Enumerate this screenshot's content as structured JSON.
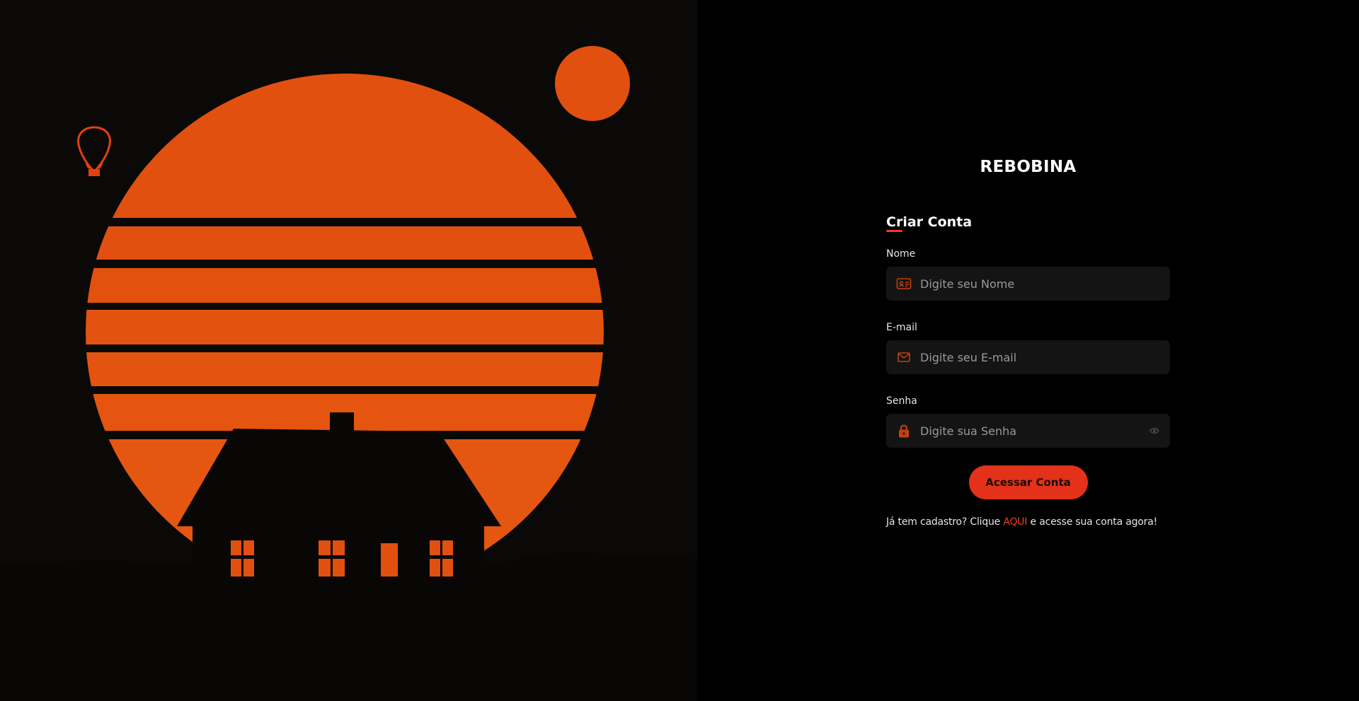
{
  "brand": {
    "name": "REBOBINA"
  },
  "form": {
    "title": "Criar Conta",
    "fields": [
      {
        "label": "Nome",
        "placeholder": "Digite seu Nome",
        "icon": "id-card-icon"
      },
      {
        "label": "E-mail",
        "placeholder": "Digite seu E-mail",
        "icon": "mail-icon"
      },
      {
        "label": "Senha",
        "placeholder": "Digite sua Senha",
        "icon": "lock-icon",
        "toggle_icon": "eye-icon"
      }
    ],
    "submit_label": "Acessar Conta",
    "footer": {
      "prefix": "Já tem cadastro? Clique ",
      "link": "AQUI",
      "suffix": " e acesse sua conta agora!"
    }
  },
  "colors": {
    "accent": "#e8401c",
    "button": "#e4321a",
    "sun": "#e2500f",
    "input_bg": "#141414",
    "background": "#000000"
  }
}
